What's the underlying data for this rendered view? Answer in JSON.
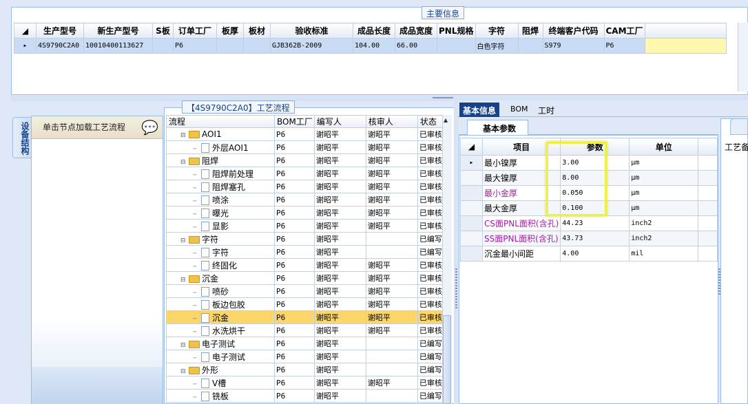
{
  "top_panel": {
    "title": "主要信息",
    "columns": [
      "生产型号",
      "新生产型号",
      "S板",
      "订单工厂",
      "板厚",
      "板材",
      "验收标准",
      "成品长度",
      "成品宽度",
      "PNL规格",
      "字符",
      "阻焊",
      "终端客户代码",
      "CAM工厂"
    ],
    "rows": [
      {
        "marker": "▸",
        "cells": [
          "4S9790C2A0",
          "10010400113627",
          "",
          "P6",
          "",
          "",
          "GJB362B-2009",
          "104.00",
          "66.00",
          "",
          "白色字符",
          "",
          "S979",
          "P6"
        ]
      }
    ]
  },
  "sidebar": {
    "tab_label": "设备结构",
    "header": "单击节点加载工艺流程"
  },
  "tree": {
    "title": "【4S9790C2A0】工艺流程",
    "columns": [
      "流程",
      "BOM工厂",
      "编写人",
      "核审人",
      "状态"
    ],
    "rows": [
      {
        "level": 0,
        "type": "folder",
        "name": "AOI1",
        "bom": "P6",
        "writer": "谢昭平",
        "reviewer": "谢昭平",
        "status": "已审核"
      },
      {
        "level": 1,
        "type": "doc",
        "name": "外层AOI1",
        "bom": "P6",
        "writer": "谢昭平",
        "reviewer": "谢昭平",
        "status": "已审核"
      },
      {
        "level": 0,
        "type": "folder",
        "name": "阻焊",
        "bom": "P6",
        "writer": "谢昭平",
        "reviewer": "谢昭平",
        "status": "已审核"
      },
      {
        "level": 1,
        "type": "doc",
        "name": "阻焊前处理",
        "bom": "P6",
        "writer": "谢昭平",
        "reviewer": "谢昭平",
        "status": "已审核"
      },
      {
        "level": 1,
        "type": "doc",
        "name": "阻焊塞孔",
        "bom": "P6",
        "writer": "谢昭平",
        "reviewer": "谢昭平",
        "status": "已审核"
      },
      {
        "level": 1,
        "type": "doc",
        "name": "喷涂",
        "bom": "P6",
        "writer": "谢昭平",
        "reviewer": "谢昭平",
        "status": "已审核"
      },
      {
        "level": 1,
        "type": "doc",
        "name": "曝光",
        "bom": "P6",
        "writer": "谢昭平",
        "reviewer": "谢昭平",
        "status": "已审核"
      },
      {
        "level": 1,
        "type": "doc",
        "name": "显影",
        "bom": "P6",
        "writer": "谢昭平",
        "reviewer": "谢昭平",
        "status": "已审核"
      },
      {
        "level": 0,
        "type": "folder",
        "name": "字符",
        "bom": "P6",
        "writer": "谢昭平",
        "reviewer": "",
        "status": "已编写"
      },
      {
        "level": 1,
        "type": "doc",
        "name": "字符",
        "bom": "P6",
        "writer": "谢昭平",
        "reviewer": "",
        "status": "已编写"
      },
      {
        "level": 1,
        "type": "doc",
        "name": "终固化",
        "bom": "P6",
        "writer": "谢昭平",
        "reviewer": "谢昭平",
        "status": "已审核"
      },
      {
        "level": 0,
        "type": "folder",
        "name": "沉金",
        "bom": "P6",
        "writer": "谢昭平",
        "reviewer": "谢昭平",
        "status": "已审核"
      },
      {
        "level": 1,
        "type": "doc",
        "name": "喷砂",
        "bom": "P6",
        "writer": "谢昭平",
        "reviewer": "谢昭平",
        "status": "已审核"
      },
      {
        "level": 1,
        "type": "doc",
        "name": "板边包胶",
        "bom": "P6",
        "writer": "谢昭平",
        "reviewer": "谢昭平",
        "status": "已审核"
      },
      {
        "level": 1,
        "type": "doc",
        "name": "沉金",
        "bom": "P6",
        "writer": "谢昭平",
        "reviewer": "谢昭平",
        "status": "已审核",
        "selected": true
      },
      {
        "level": 1,
        "type": "doc",
        "name": "水洗烘干",
        "bom": "P6",
        "writer": "谢昭平",
        "reviewer": "谢昭平",
        "status": "已审核"
      },
      {
        "level": 0,
        "type": "folder",
        "name": "电子测试",
        "bom": "P6",
        "writer": "谢昭平",
        "reviewer": "",
        "status": "已编写"
      },
      {
        "level": 1,
        "type": "doc",
        "name": "电子测试",
        "bom": "P6",
        "writer": "谢昭平",
        "reviewer": "",
        "status": "已编写"
      },
      {
        "level": 0,
        "type": "folder",
        "name": "外形",
        "bom": "P6",
        "writer": "谢昭平",
        "reviewer": "",
        "status": "已编写"
      },
      {
        "level": 1,
        "type": "doc",
        "name": "V槽",
        "bom": "P6",
        "writer": "谢昭平",
        "reviewer": "谢昭平",
        "status": "已审核"
      },
      {
        "level": 1,
        "type": "doc",
        "name": "铣板",
        "bom": "P6",
        "writer": "谢昭平",
        "reviewer": "",
        "status": "已编写"
      }
    ]
  },
  "tabs": [
    "基本信息",
    "BOM",
    "工时"
  ],
  "basic_params": {
    "subtab": "基本参数",
    "columns": [
      "项目",
      "参数",
      "单位"
    ],
    "rows": [
      {
        "item": "最小镍厚",
        "value": "3.00",
        "unit": "μm",
        "purple": false
      },
      {
        "item": "最大镍厚",
        "value": "8.00",
        "unit": "μm",
        "purple": false
      },
      {
        "item": "最小金厚",
        "value": "0.050",
        "unit": "μm",
        "purple": true
      },
      {
        "item": "最大金厚",
        "value": "0.100",
        "unit": "μm",
        "purple": false
      },
      {
        "item": "CS面PNL面积(含孔)",
        "value": "44.23",
        "unit": "inch2",
        "purple": true
      },
      {
        "item": "SS面PNL面积(含孔)",
        "value": "43.73",
        "unit": "inch2",
        "purple": true
      },
      {
        "item": "沉金最小间距",
        "value": "4.00",
        "unit": "mil",
        "purple": false
      }
    ]
  },
  "far_right": {
    "label": "工艺备"
  }
}
